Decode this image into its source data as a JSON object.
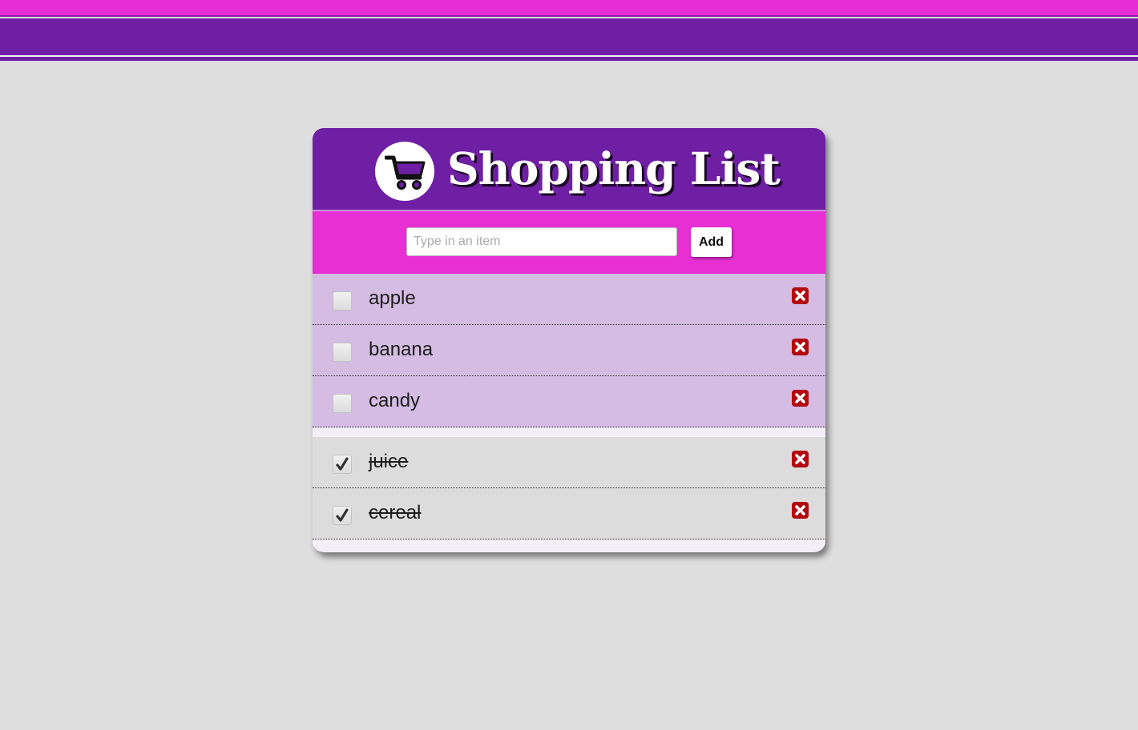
{
  "app": {
    "title": "Shopping List"
  },
  "colors": {
    "header_purple": "#6f1fa3",
    "accent_pink": "#e72fd4",
    "todo_row": "#d4bce3",
    "done_row": "#dcdcdc",
    "delete_red": "#b3080d",
    "background": "#dedede"
  },
  "add_form": {
    "placeholder": "Type in an item",
    "value": "",
    "add_label": "Add"
  },
  "icons": {
    "header": "shopping-cart-icon",
    "delete": "delete-x-icon",
    "check": "check-mark-icon"
  },
  "todo_items": [
    {
      "label": "apple",
      "checked": false
    },
    {
      "label": "banana",
      "checked": false
    },
    {
      "label": "candy",
      "checked": false
    }
  ],
  "done_items": [
    {
      "label": "juice",
      "checked": true
    },
    {
      "label": "cereal",
      "checked": true
    }
  ]
}
